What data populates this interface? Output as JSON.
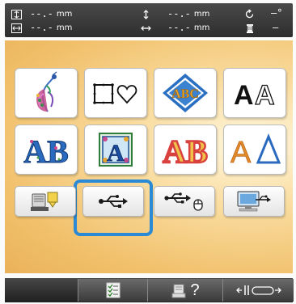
{
  "status_bar": {
    "height_value": "--.-",
    "width_value": "--.-",
    "vertical_value": "--.-",
    "horizontal_value": "--.-",
    "unit": "mm",
    "angle_value": "–°",
    "thread_value": "–"
  },
  "pattern_categories": [
    {
      "name": "embroidery-patterns"
    },
    {
      "name": "frame-patterns"
    },
    {
      "name": "monogram-patterns",
      "label": "ABC"
    },
    {
      "name": "alphabet-fonts",
      "label": "AA"
    },
    {
      "name": "decorative-alphabet",
      "label": "AB"
    },
    {
      "name": "floral-alphabet",
      "label": "A"
    },
    {
      "name": "applique-alphabet",
      "label": "AB"
    },
    {
      "name": "greek-alphabet",
      "label": "AΔ"
    }
  ],
  "source_buttons": [
    {
      "name": "machine-memory"
    },
    {
      "name": "usb-media"
    },
    {
      "name": "usb-computer"
    },
    {
      "name": "computer-connection"
    }
  ],
  "bottom_bar": {
    "help_label": "?"
  },
  "colors": {
    "selection_ring": "#2a8ad6",
    "panel_gradient": "#f1c06b",
    "usb_icon": "#1a1a1a"
  }
}
